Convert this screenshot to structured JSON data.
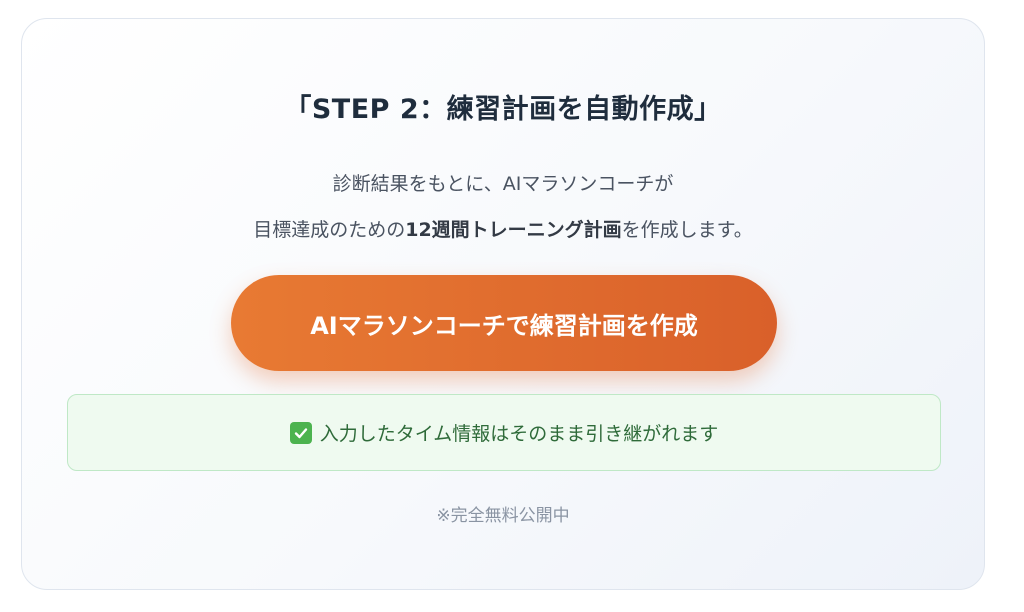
{
  "step": {
    "title": "「STEP 2：練習計画を自動作成」"
  },
  "description": {
    "line1": "診断結果をもとに、AIマラソンコーチが",
    "line2_prefix": "目標達成のための",
    "line2_bold": "12週間トレーニング計画",
    "line2_suffix": "を作成します。"
  },
  "cta": {
    "label": "AIマラソンコーチで練習計画を作成"
  },
  "notice": {
    "icon": "check-icon",
    "text": "入力したタイム情報はそのまま引き継がれます"
  },
  "footnote": {
    "text": "※完全無料公開中"
  },
  "colors": {
    "accent": "#e06a2e",
    "notice_background": "#effaf0",
    "notice_border": "#bfe8c6",
    "check_green": "#4cb34f"
  }
}
